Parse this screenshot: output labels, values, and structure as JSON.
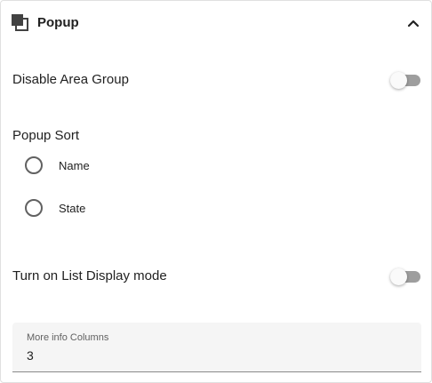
{
  "header": {
    "title": "Popup",
    "icon": "popup-window-icon",
    "collapse_icon": "chevron-up-icon"
  },
  "settings": {
    "disable_area_group": {
      "label": "Disable Area Group",
      "enabled": false
    },
    "popup_sort": {
      "title": "Popup Sort",
      "options": [
        {
          "label": "Name",
          "selected": false
        },
        {
          "label": "State",
          "selected": false
        }
      ]
    },
    "list_display_mode": {
      "label": "Turn on List Display mode",
      "enabled": false
    },
    "more_info_columns": {
      "label": "More info Columns",
      "value": "3"
    }
  },
  "colors": {
    "toggle_off_track": "#9e9e9e",
    "toggle_thumb": "#fafafa",
    "field_background": "#f5f5f5",
    "text": "#212121"
  }
}
